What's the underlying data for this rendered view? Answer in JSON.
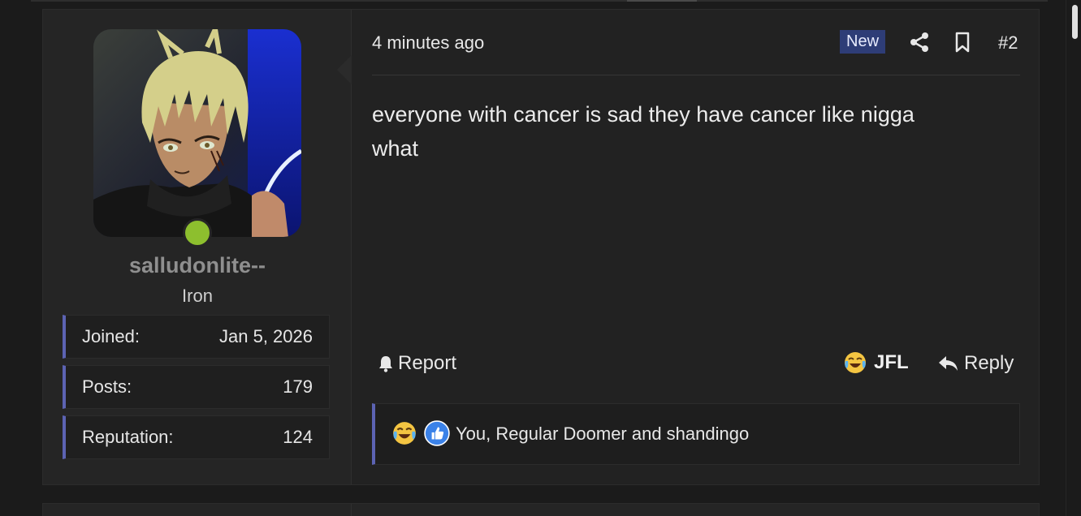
{
  "post": {
    "author": {
      "username": "salludonlite--",
      "title": "Iron",
      "online": true,
      "stats": [
        {
          "label": "Joined:",
          "value": "Jan 5, 2026"
        },
        {
          "label": "Posts:",
          "value": "179"
        },
        {
          "label": "Reputation:",
          "value": "124"
        }
      ]
    },
    "time": "4 minutes ago",
    "badge": "New",
    "number": "#2",
    "message_line1": "everyone with cancer is sad they have cancer like nigga",
    "message_line2": "what",
    "actions": {
      "report": "Report",
      "react": "JFL",
      "reply": "Reply"
    },
    "reactions": {
      "icons": [
        "crying-laughing-emoji-icon",
        "thumbs-up-icon"
      ],
      "text": "You, Regular Doomer and shandingo"
    }
  },
  "colors": {
    "accent": "#5c63b3",
    "badge_bg": "#2e3d77",
    "online": "#8dbf2e"
  }
}
